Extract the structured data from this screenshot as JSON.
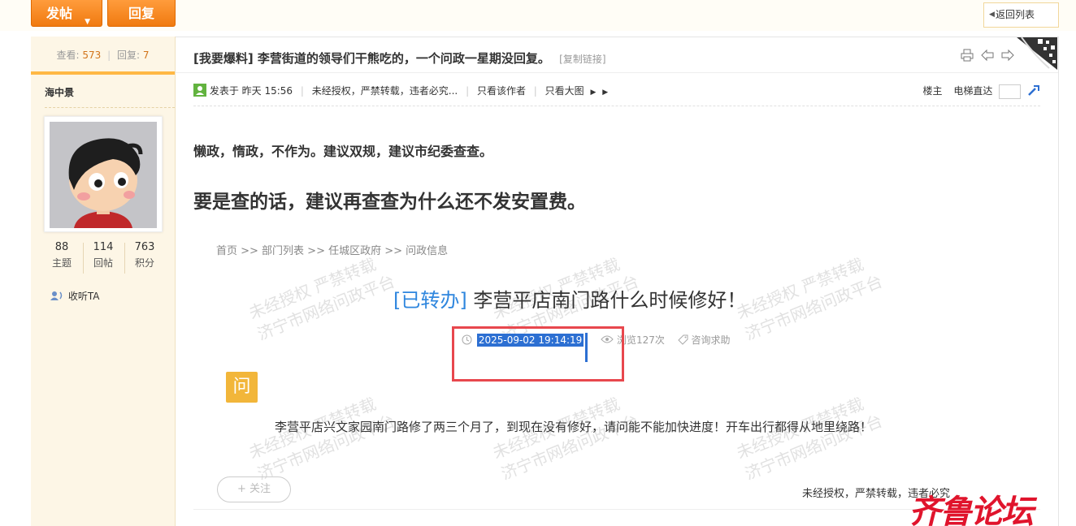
{
  "toolbar": {
    "post_label": "发帖",
    "reply_label": "回复",
    "back_label": "返回列表"
  },
  "sidebar": {
    "views_label": "查看:",
    "views": "573",
    "replies_label": "回复:",
    "replies": "7",
    "username": "海中景",
    "stats": [
      {
        "value": "88",
        "label": "主题"
      },
      {
        "value": "114",
        "label": "回帖"
      },
      {
        "value": "763",
        "label": "积分"
      }
    ],
    "follow_label": "收听TA"
  },
  "post": {
    "title": "[我要爆料] 李营街道的领导们干熊吃的，一个问政一星期没回复。",
    "copy_link": "[复制链接]",
    "posted_label": "发表于",
    "posted_time": "昨天 15:56",
    "copyright": "未经授权，严禁转载，违者必究...",
    "only_author": "只看该作者",
    "big_image": "只看大图",
    "floor": "楼主",
    "elevator": "电梯直达",
    "line1": "懒政，惰政，不作为。建议双规，建议市纪委查查。",
    "line2": "要是查的话，建议再查查为什么还不发安置费。"
  },
  "embedded": {
    "breadcrumb": "首页 >> 部门列表 >> 任城区政府 >> 问政信息",
    "status_tag": "[已转办]",
    "title": "李营平店南门路什么时候修好！",
    "date": "2025-09-02 19:14:19",
    "views": "浏览127次",
    "category": "咨询求助",
    "q_badge": "问",
    "content": "李营平店兴文家园南门路修了两三个月了，到现在没有修好，请问能不能加快进度！开车出行都得从地里绕路！",
    "follow_btn": "+ 关注",
    "note": "未经授权，严禁转载，违者必究",
    "watermark_line1": "未经授权    严禁转载",
    "watermark_line2": "济宁市网络问政平台"
  },
  "logo_text": "齐鲁论坛",
  "colors": {
    "accent_orange": "#f07a10",
    "status_blue": "#2e86de",
    "highlight_red": "#e8474d",
    "logo_red": "#e0142c"
  }
}
